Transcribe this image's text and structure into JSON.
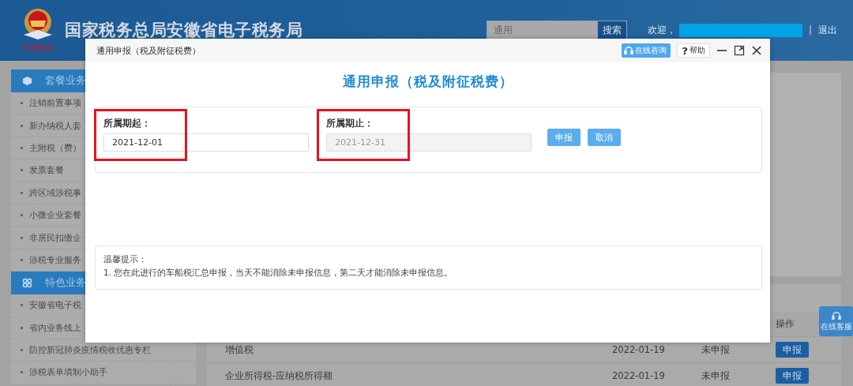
{
  "header": {
    "logo_text": "中国税务",
    "title": "国家税务总局安徽省电子税务局",
    "search": {
      "placeholder": "通用"
    },
    "search_button": "搜索",
    "welcome": "欢迎，",
    "separator": "|",
    "logout": "退出"
  },
  "sidebar": {
    "sections": [
      {
        "title": "套餐业务",
        "items": [
          "注销前置事项",
          "新办纳税人套",
          "主附税（费）",
          "发票套餐",
          "跨区域涉税事",
          "小微企业套餐",
          "非居民扣缴企",
          "涉税专业服务"
        ]
      },
      {
        "title": "特色业务",
        "items": [
          "安徽省电子税",
          "省内业务线上",
          "防控新冠肺炎疫情税收优惠专栏",
          "涉税表单填制小助手"
        ]
      }
    ]
  },
  "table": {
    "columns": [
      "操作"
    ],
    "rows": [
      {
        "name": "增值税",
        "date": "2022-01-19",
        "status": "未申报",
        "action": "申报"
      },
      {
        "name": "企业所得税-应纳税所得额",
        "date": "2022-01-19",
        "status": "未申报",
        "action": "申报"
      }
    ]
  },
  "service_button": "在线客服",
  "dialog": {
    "title": "通用申报（税及附征税费）",
    "consult_button": "在线咨询",
    "help_button": {
      "mark": "?",
      "label": "帮助"
    },
    "heading": "通用申报（税及附征税费）",
    "fields": [
      {
        "label": "所属期起：",
        "value": "2021-12-01",
        "disabled": false,
        "highlighted": true
      },
      {
        "label": "所属期止：",
        "value": "2021-12-31",
        "disabled": true,
        "highlighted": true
      }
    ],
    "buttons": [
      "申报",
      "取消"
    ],
    "tips": {
      "title": "温馨提示：",
      "lines": [
        "1. 您在此进行的车船税汇总申报，当天不能消除未申报信息，第二天才能消除未申报信息。"
      ]
    }
  }
}
